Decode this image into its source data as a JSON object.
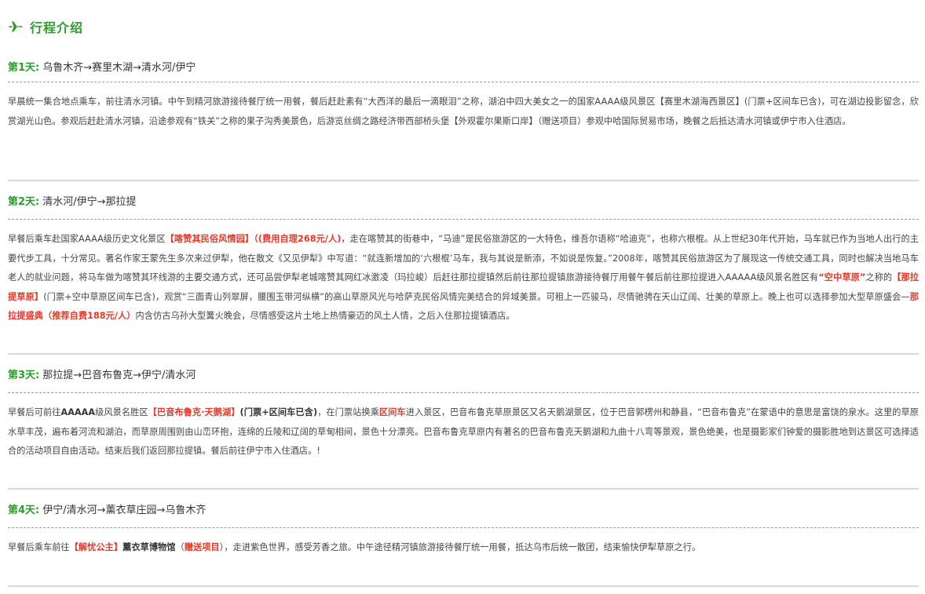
{
  "header": {
    "title": "行程介绍",
    "icon": "airplane-icon",
    "accent": "#2f9a2f"
  },
  "highlight_color": "#e23b2a",
  "days": [
    {
      "label": "第1天:",
      "route": "乌鲁木齐→赛里木湖→清水河/伊宁",
      "desc": [
        "早晨统一集合地点乘车，前往清水河镇。中午到精河旅游接待餐厅统一用餐，餐后赶赴素有“大西洋的最后一滴眼泪”之称，湖泊中四大美女之一的国家AAAA级风景区【赛里木湖海西景区】(门票+区间车已含)，可在湖边投影留念，欣赏湖光山色。参观后赶赴清水河镇，沿途参观有“铁关”之称的果子沟秀美景色，后游览丝绸之路经济带西部桥头堡【外观霍尔果斯口岸】（赠送项目）参观中哈国际贸易市场，晚餐之后抵达清水河镇或伊宁市入住酒店。"
      ]
    },
    {
      "label": "第2天:",
      "route": "清水河/伊宁→那拉提",
      "desc": [
        "早餐后乘车赴国家AAAA级历史文化景区",
        "【喀赞其民俗风情园】（(费用自理268元/人)",
        "，走在喀赞其的街巷中，“马迪”是民俗旅游区的一大特色，维吾尔语称“哈迪克”，也称六根棍。从上世纪30年代开始，马车就已作为当地人出行的主要代步工具，十分常见。著名作家王蒙先生多次来过伊犁，他在散文《又见伊犁》中写道：“就连新增加的‘六根棍’马车，我与其说是新添，不如说是恢复。”2008年，喀赞其民俗旅游区为了展现这一传统交通工具，同时也解决当地马车老人的就业问题，将马车做为喀赞其环线游的主要交通方式，还可品尝伊犁老城喀赞其网红冰激凌（玛拉峻）后赶往那拉提镇然后前往那拉提镇旅游接待餐厅用餐午餐后前往那拉提进入AAAAA级风景名胜区有",
        "“空中草原”",
        "之称的",
        "【那拉提草原】",
        "(门票+空中草原区间车已含)，观赏“三面青山列翠屏，腰围玉带河纵横”的高山草原风光与哈萨克民俗风情完美结合的异域美景。可租上一匹骏马，尽情驰骋在天山辽阔、壮美的草原上。晚上也可以选择参加大型草原盛会—",
        "那拉提盛典（推荐自费188元/人）",
        "内含仿古乌孙大型篝火晚会，尽情感受这片土地上热情豪迈的风土人情，之后入住那拉提镇酒店。"
      ]
    },
    {
      "label": "第3天:",
      "route": "那拉提→巴音布鲁克→伊宁/清水河",
      "desc": [
        "早餐后可前往",
        "AAAAA",
        "级风景名胜区",
        "【巴音布鲁克·天鹅湖】",
        "(门票+区间车已含)",
        "，在门票站换乘",
        "区间车",
        "进入景区，巴音布鲁克草原景区又名天鹅湖景区，位于巴音郭楞州和静县，“巴音布鲁克”在蒙语中的意思是富饶的泉水。这里的草原水草丰茂，遍布着河流和湖泊，而草原周围则由山峦环抱，连绵的丘陵和辽阔的草甸相间，景色十分漂亮。巴音布鲁克草原内有著名的巴音布鲁克天鹅湖和九曲十八弯等景观，景色绝美，也是摄影家们钟爱的摄影胜地到达景区可选择适合的活动项目自由活动。结束后我们返回那拉提镇。餐后前往伊宁市入住酒店。!"
      ]
    },
    {
      "label": "第4天:",
      "route": "伊宁/清水河→薰衣草庄园→乌鲁木齐",
      "desc": [
        "早餐后乘车前往",
        "【解忧公主】",
        "薰衣草博物馆",
        "（",
        "赠送项目",
        "），走进紫色世界，感受芳香之旅。中午途径精河镇旅游接待餐厅统一用餐，抵达乌市后统一散团，结束愉快伊犁草原之行。"
      ]
    }
  ]
}
